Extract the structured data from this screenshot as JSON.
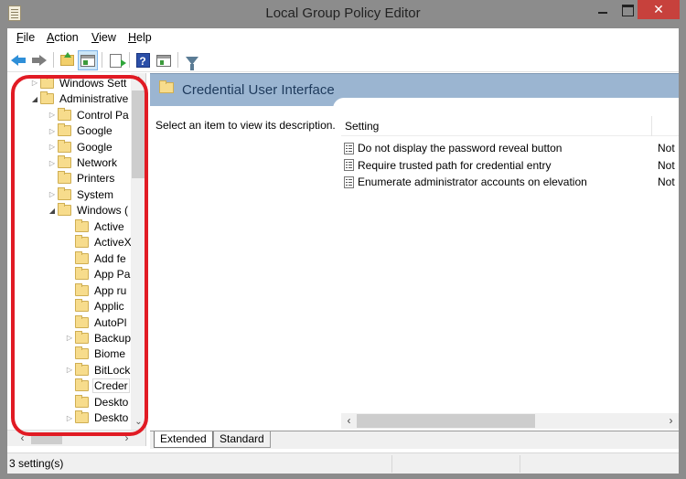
{
  "window": {
    "title": "Local Group Policy Editor",
    "close_glyph": "✕"
  },
  "menu": {
    "items": [
      {
        "label": "File",
        "mnemonic": "F",
        "rest": "ile"
      },
      {
        "label": "Action",
        "mnemonic": "A",
        "rest": "ction"
      },
      {
        "label": "View",
        "mnemonic": "V",
        "rest": "iew"
      },
      {
        "label": "Help",
        "mnemonic": "H",
        "rest": "elp"
      }
    ]
  },
  "toolbar": {
    "items": [
      "back",
      "forward",
      "up-one-level",
      "show-hide-console-tree",
      "export-list",
      "help",
      "show-hide-action-pane",
      "filter"
    ],
    "help_glyph": "?"
  },
  "tree": {
    "items": [
      {
        "label": "Windows Sett",
        "level": 0,
        "expander": "▷"
      },
      {
        "label": "Administrative",
        "level": 0,
        "expander": "◢"
      },
      {
        "label": "Control Pa",
        "level": 1,
        "expander": "▷"
      },
      {
        "label": "Google",
        "level": 1,
        "expander": "▷"
      },
      {
        "label": "Google",
        "level": 1,
        "expander": "▷"
      },
      {
        "label": "Network",
        "level": 1,
        "expander": "▷"
      },
      {
        "label": "Printers",
        "level": 1,
        "expander": ""
      },
      {
        "label": "System",
        "level": 1,
        "expander": "▷"
      },
      {
        "label": "Windows (",
        "level": 1,
        "expander": "◢"
      },
      {
        "label": "Active",
        "level": 2,
        "expander": ""
      },
      {
        "label": "ActiveX",
        "level": 2,
        "expander": ""
      },
      {
        "label": "Add fe",
        "level": 2,
        "expander": ""
      },
      {
        "label": "App Pa",
        "level": 2,
        "expander": ""
      },
      {
        "label": "App ru",
        "level": 2,
        "expander": ""
      },
      {
        "label": "Applic",
        "level": 2,
        "expander": ""
      },
      {
        "label": "AutoPl",
        "level": 2,
        "expander": ""
      },
      {
        "label": "Backup",
        "level": 2,
        "expander": "▷"
      },
      {
        "label": "Biome",
        "level": 2,
        "expander": ""
      },
      {
        "label": "BitLock",
        "level": 2,
        "expander": "▷"
      },
      {
        "label": "Creder",
        "level": 2,
        "expander": "",
        "selected": true
      },
      {
        "label": "Deskto",
        "level": 2,
        "expander": ""
      },
      {
        "label": "Deskto",
        "level": 2,
        "expander": "▷"
      }
    ],
    "scroll_up": "⌃",
    "scroll_down": "⌄",
    "scroll_left": "‹",
    "scroll_right": "›"
  },
  "content": {
    "header_title": "Credential User Interface",
    "description": "Select an item to view its description.",
    "column_setting": "Setting",
    "settings": [
      {
        "name": "Do not display the password reveal button",
        "state": "Not"
      },
      {
        "name": "Require trusted path for credential entry",
        "state": "Not"
      },
      {
        "name": "Enumerate administrator accounts on elevation",
        "state": "Not"
      }
    ],
    "scroll_left": "‹",
    "scroll_right": "›"
  },
  "tabs": [
    {
      "label": "Extended",
      "active": true
    },
    {
      "label": "Standard",
      "active": false
    }
  ],
  "status": {
    "text": "3 setting(s)"
  },
  "colors": {
    "header_band": "#9bb5d1",
    "highlight_outline": "#e11b24",
    "close_button": "#c7413c"
  }
}
